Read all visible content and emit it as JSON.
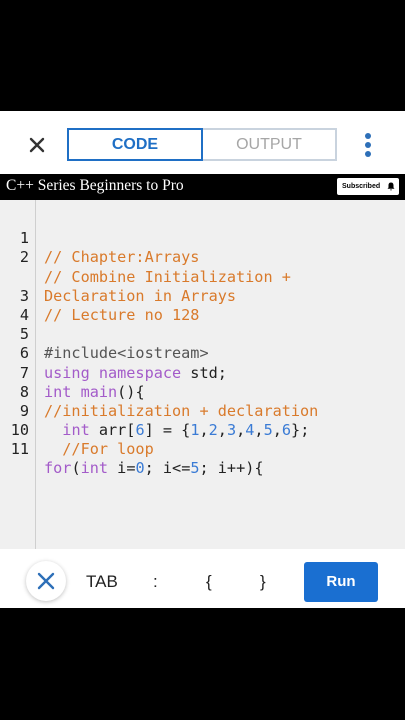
{
  "header": {
    "tabs": [
      {
        "label": "CODE",
        "active": true
      },
      {
        "label": "OUTPUT",
        "active": false
      }
    ],
    "close_icon": "close-icon",
    "menu_icon": "more-vertical-icon"
  },
  "banner": {
    "title": "C++ Series Beginners to Pro",
    "subscribed_label": "Subscribed",
    "bell_icon": "bell-icon"
  },
  "editor": {
    "line_numbers": [
      "1",
      "2",
      "",
      "3",
      "4",
      "5",
      "6",
      "7",
      "8",
      "9",
      "10",
      "11"
    ],
    "lines": [
      "// Chapter:Arrays",
      "// Combine Initialization +",
      "Declaration in Arrays",
      "// Lecture no 128",
      "",
      "#include<iostream>",
      "using namespace std;",
      "int main(){",
      "//initialization + declaration",
      "  int arr[6] = {1,2,3,4,5,6};",
      "  //For loop",
      "for(int i=0; i<=5; i++){"
    ]
  },
  "toolbar": {
    "close_icon": "close-icon",
    "keys": [
      "TAB",
      ":",
      "{",
      "}"
    ],
    "run_label": "Run"
  },
  "colors": {
    "accent": "#1f6fc5",
    "run_button": "#1a6fd1",
    "comment": "#d97a2b",
    "keyword": "#a35bc9",
    "number": "#3a7bd5",
    "editor_bg": "#f0f0f0"
  }
}
